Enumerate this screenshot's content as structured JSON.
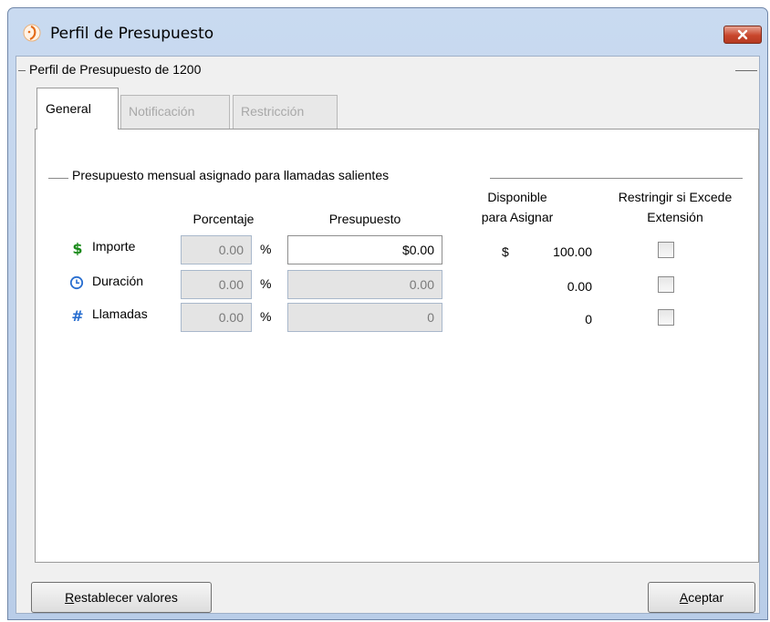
{
  "window": {
    "title": "Perfil de Presupuesto",
    "close_label": "×"
  },
  "profile_group": {
    "title": "Perfil de Presupuesto de 1200"
  },
  "tabs": [
    {
      "label": "General",
      "active": true
    },
    {
      "label": "Notificación",
      "active": false
    },
    {
      "label": "Restricción",
      "active": false
    }
  ],
  "budget_section": {
    "title": "Presupuesto mensual asignado para llamadas salientes",
    "columns": {
      "percentage": "Porcentaje",
      "budget": "Presupuesto",
      "available_line1": "Disponible",
      "available_line2": "para Asignar",
      "restrict_line1": "Restringir si Excede",
      "restrict_line2": "Extensión"
    },
    "rows": [
      {
        "icon": "dollar-icon",
        "label": "Importe",
        "percent": "0.00",
        "percent_symbol": "%",
        "budget": "$0.00",
        "available_symbol": "$",
        "available": "100.00",
        "restrict": false
      },
      {
        "icon": "clock-icon",
        "label": "Duración",
        "percent": "0.00",
        "percent_symbol": "%",
        "budget": "0.00",
        "available_symbol": "",
        "available": "0.00",
        "restrict": false
      },
      {
        "icon": "hash-icon",
        "label": "Llamadas",
        "percent": "0.00",
        "percent_symbol": "%",
        "budget": "0",
        "available_symbol": "",
        "available": "0",
        "restrict": false
      }
    ]
  },
  "buttons": {
    "reset_first": "R",
    "reset_rest": "establecer valores",
    "ok_first": "A",
    "ok_rest": "ceptar"
  },
  "colors": {
    "dollar_icon": "#1a8a1a",
    "clock_icon": "#2a6fd0",
    "hash_icon": "#2a6fd0",
    "close_button": "#c8462c"
  }
}
